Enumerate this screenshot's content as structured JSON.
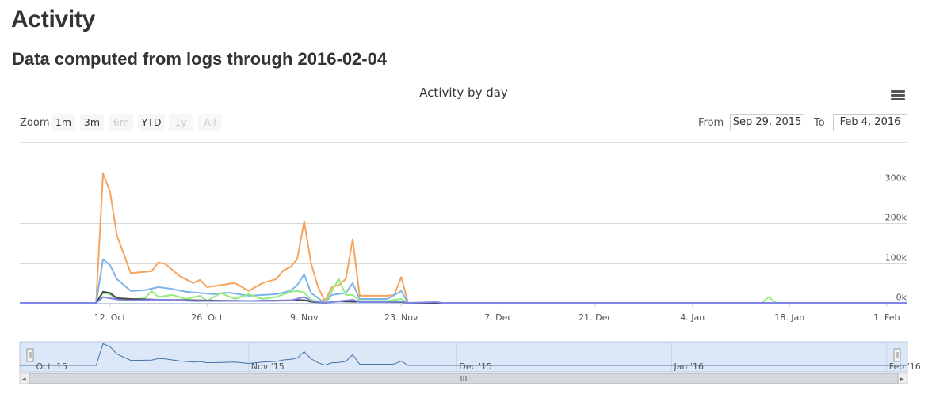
{
  "page": {
    "heading": "Activity",
    "subheading": "Data computed from logs through 2016-02-04"
  },
  "controls": {
    "zoom_label": "Zoom",
    "zoom_buttons": [
      {
        "label": "1m",
        "enabled": true
      },
      {
        "label": "3m",
        "enabled": true
      },
      {
        "label": "6m",
        "enabled": false
      },
      {
        "label": "YTD",
        "enabled": true
      },
      {
        "label": "1y",
        "enabled": false
      },
      {
        "label": "All",
        "enabled": false
      }
    ],
    "from_label": "From",
    "from_value": "Sep 29, 2015",
    "to_label": "To",
    "to_value": "Feb 4, 2016",
    "menu_icon": "hamburger-menu-icon"
  },
  "chart_data": {
    "type": "line",
    "title": "Activity by day",
    "xlabel": "",
    "ylabel": "",
    "x_range": [
      "2015-09-29",
      "2016-02-04"
    ],
    "ylim": [
      0,
      330000
    ],
    "y_ticks": [
      "0k",
      "100k",
      "200k",
      "300k"
    ],
    "x_ticks": [
      "12. Oct",
      "26. Oct",
      "9. Nov",
      "23. Nov",
      "7. Dec",
      "21. Dec",
      "4. Jan",
      "18. Jan",
      "1. Feb"
    ],
    "grid": true,
    "legend": "none",
    "series": [
      {
        "color": "#f7a35c",
        "points": [
          [
            "2015-09-29",
            0
          ],
          [
            "2015-10-10",
            0
          ],
          [
            "2015-10-11",
            325000
          ],
          [
            "2015-10-12",
            280000
          ],
          [
            "2015-10-13",
            170000
          ],
          [
            "2015-10-15",
            75000
          ],
          [
            "2015-10-17",
            78000
          ],
          [
            "2015-10-18",
            80000
          ],
          [
            "2015-10-19",
            102000
          ],
          [
            "2015-10-20",
            98000
          ],
          [
            "2015-10-22",
            68000
          ],
          [
            "2015-10-24",
            50000
          ],
          [
            "2015-10-25",
            58000
          ],
          [
            "2015-10-26",
            40000
          ],
          [
            "2015-10-28",
            45000
          ],
          [
            "2015-10-30",
            50000
          ],
          [
            "2015-11-01",
            30000
          ],
          [
            "2015-11-03",
            50000
          ],
          [
            "2015-11-05",
            60000
          ],
          [
            "2015-11-06",
            82000
          ],
          [
            "2015-11-07",
            90000
          ],
          [
            "2015-11-08",
            110000
          ],
          [
            "2015-11-09",
            205000
          ],
          [
            "2015-11-10",
            100000
          ],
          [
            "2015-11-11",
            40000
          ],
          [
            "2015-11-12",
            5000
          ],
          [
            "2015-11-13",
            40000
          ],
          [
            "2015-11-14",
            45000
          ],
          [
            "2015-11-15",
            60000
          ],
          [
            "2015-11-16",
            160000
          ],
          [
            "2015-11-17",
            18000
          ],
          [
            "2015-11-21",
            18000
          ],
          [
            "2015-11-22",
            20000
          ],
          [
            "2015-11-23",
            65000
          ],
          [
            "2015-11-24",
            0
          ],
          [
            "2016-02-04",
            0
          ]
        ]
      },
      {
        "color": "#7cb5ec",
        "points": [
          [
            "2015-09-29",
            0
          ],
          [
            "2015-10-10",
            0
          ],
          [
            "2015-10-11",
            110000
          ],
          [
            "2015-10-12",
            95000
          ],
          [
            "2015-10-13",
            60000
          ],
          [
            "2015-10-15",
            30000
          ],
          [
            "2015-10-17",
            32000
          ],
          [
            "2015-10-19",
            40000
          ],
          [
            "2015-10-21",
            35000
          ],
          [
            "2015-10-23",
            28000
          ],
          [
            "2015-10-25",
            25000
          ],
          [
            "2015-10-27",
            22000
          ],
          [
            "2015-10-29",
            26000
          ],
          [
            "2015-11-01",
            18000
          ],
          [
            "2015-11-03",
            20000
          ],
          [
            "2015-11-05",
            22000
          ],
          [
            "2015-11-07",
            30000
          ],
          [
            "2015-11-08",
            45000
          ],
          [
            "2015-11-09",
            72000
          ],
          [
            "2015-11-10",
            25000
          ],
          [
            "2015-11-12",
            0
          ],
          [
            "2015-11-13",
            20000
          ],
          [
            "2015-11-15",
            25000
          ],
          [
            "2015-11-16",
            50000
          ],
          [
            "2015-11-17",
            10000
          ],
          [
            "2015-11-21",
            10000
          ],
          [
            "2015-11-23",
            30000
          ],
          [
            "2015-11-24",
            0
          ],
          [
            "2016-02-04",
            0
          ]
        ]
      },
      {
        "color": "#90ed7d",
        "points": [
          [
            "2015-09-29",
            0
          ],
          [
            "2015-10-10",
            0
          ],
          [
            "2015-10-11",
            25000
          ],
          [
            "2015-10-12",
            22000
          ],
          [
            "2015-10-13",
            10000
          ],
          [
            "2015-10-15",
            8000
          ],
          [
            "2015-10-17",
            12000
          ],
          [
            "2015-10-18",
            30000
          ],
          [
            "2015-10-19",
            15000
          ],
          [
            "2015-10-21",
            20000
          ],
          [
            "2015-10-23",
            10000
          ],
          [
            "2015-10-25",
            18000
          ],
          [
            "2015-10-26",
            5000
          ],
          [
            "2015-10-28",
            25000
          ],
          [
            "2015-10-30",
            10000
          ],
          [
            "2015-11-01",
            22000
          ],
          [
            "2015-11-03",
            10000
          ],
          [
            "2015-11-05",
            15000
          ],
          [
            "2015-11-07",
            28000
          ],
          [
            "2015-11-08",
            30000
          ],
          [
            "2015-11-09",
            26000
          ],
          [
            "2015-11-10",
            8000
          ],
          [
            "2015-11-12",
            0
          ],
          [
            "2015-11-13",
            30000
          ],
          [
            "2015-11-14",
            60000
          ],
          [
            "2015-11-15",
            20000
          ],
          [
            "2015-11-16",
            20000
          ],
          [
            "2015-11-17",
            5000
          ],
          [
            "2015-11-21",
            5000
          ],
          [
            "2015-11-23",
            10000
          ],
          [
            "2015-11-24",
            0
          ],
          [
            "2016-01-14",
            0
          ],
          [
            "2016-01-15",
            15000
          ],
          [
            "2016-01-16",
            0
          ],
          [
            "2016-02-04",
            0
          ]
        ]
      },
      {
        "color": "#434348",
        "points": [
          [
            "2015-09-29",
            0
          ],
          [
            "2015-10-10",
            0
          ],
          [
            "2015-10-11",
            28000
          ],
          [
            "2015-10-12",
            25000
          ],
          [
            "2015-10-13",
            12000
          ],
          [
            "2015-10-15",
            10000
          ],
          [
            "2015-10-19",
            8000
          ],
          [
            "2015-10-23",
            7000
          ],
          [
            "2015-10-27",
            6000
          ],
          [
            "2015-11-01",
            5000
          ],
          [
            "2015-11-05",
            6000
          ],
          [
            "2015-11-09",
            7000
          ],
          [
            "2015-11-10",
            3000
          ],
          [
            "2015-11-12",
            0
          ],
          [
            "2015-11-14",
            4000
          ],
          [
            "2015-11-16",
            3000
          ],
          [
            "2015-11-23",
            2000
          ],
          [
            "2015-11-24",
            0
          ],
          [
            "2016-02-04",
            0
          ]
        ]
      },
      {
        "color": "#8085e9",
        "points": [
          [
            "2015-09-29",
            0
          ],
          [
            "2015-10-10",
            0
          ],
          [
            "2015-10-11",
            15000
          ],
          [
            "2015-10-12",
            12000
          ],
          [
            "2015-10-14",
            6000
          ],
          [
            "2015-10-19",
            8000
          ],
          [
            "2015-10-24",
            5000
          ],
          [
            "2015-10-30",
            5000
          ],
          [
            "2015-11-03",
            5000
          ],
          [
            "2015-11-07",
            6000
          ],
          [
            "2015-11-09",
            15000
          ],
          [
            "2015-11-10",
            5000
          ],
          [
            "2015-11-12",
            0
          ],
          [
            "2015-11-16",
            8000
          ],
          [
            "2015-11-17",
            2000
          ],
          [
            "2015-11-23",
            3000
          ],
          [
            "2015-11-24",
            0
          ],
          [
            "2015-11-28",
            2000
          ],
          [
            "2015-11-29",
            0
          ],
          [
            "2016-02-04",
            0
          ]
        ]
      }
    ],
    "navigator": {
      "labels": [
        "Oct '15",
        "Nov '15",
        "Dec '15",
        "Jan '16",
        "Feb '16"
      ]
    }
  }
}
